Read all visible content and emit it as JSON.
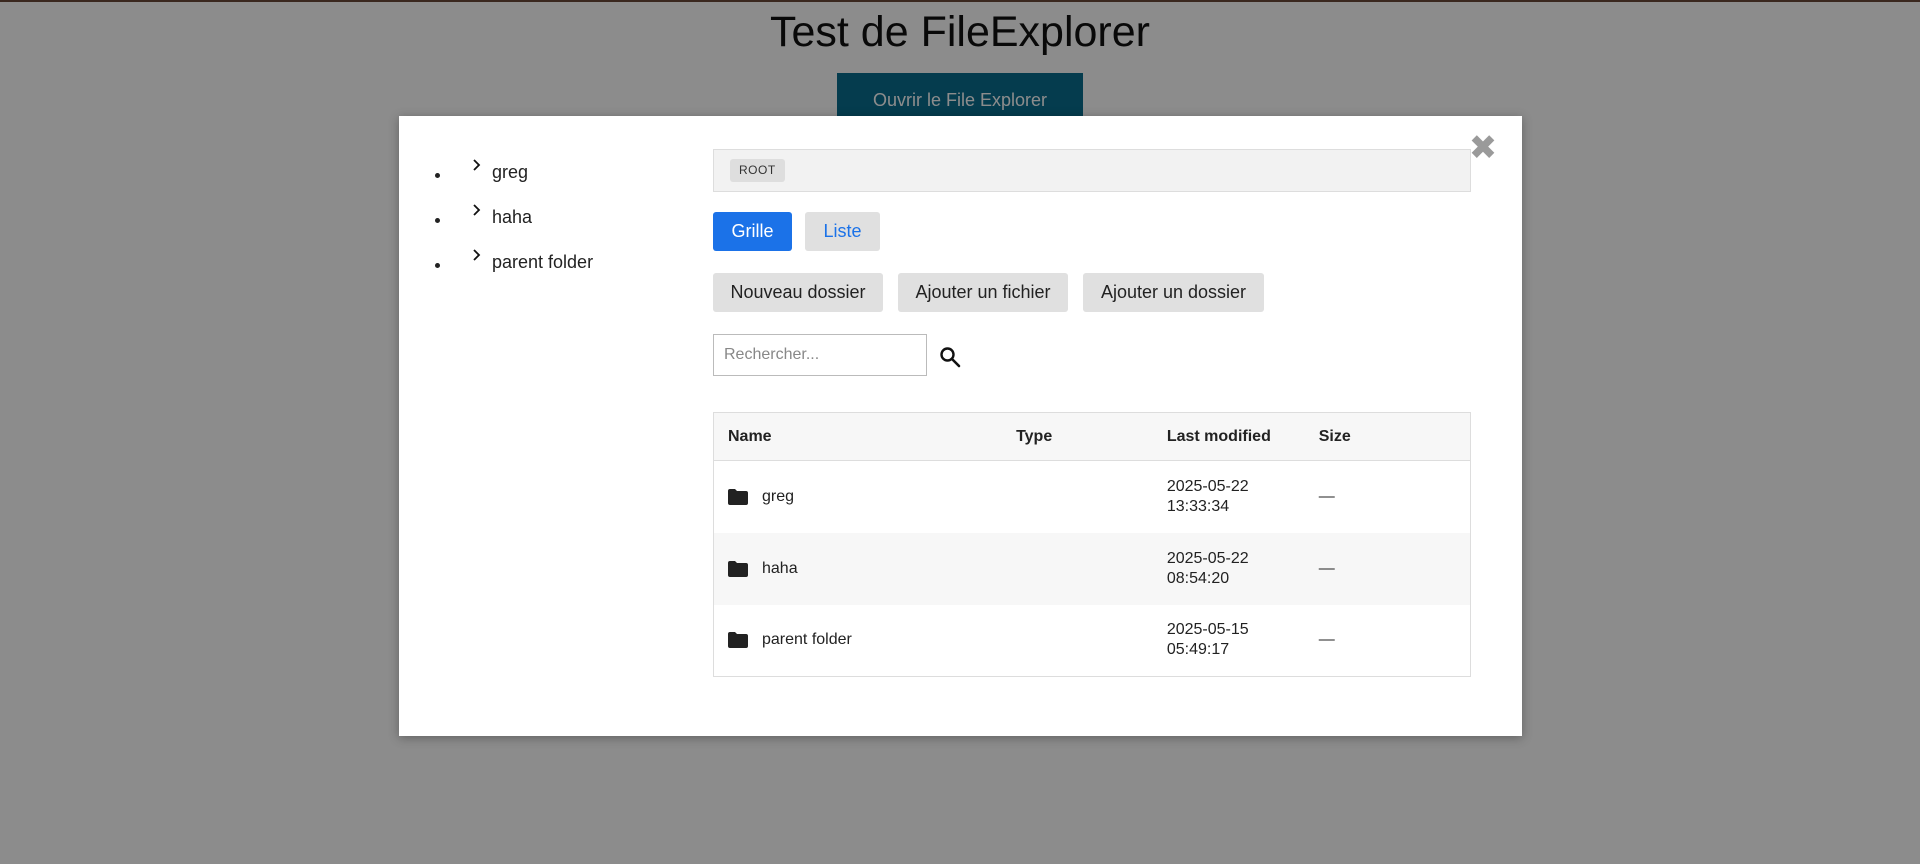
{
  "page": {
    "title": "Test de FileExplorer",
    "open_button": "Ouvrir le File Explorer"
  },
  "modal": {
    "close_label": "✖",
    "tree": [
      {
        "label": "greg"
      },
      {
        "label": "haha"
      },
      {
        "label": "parent folder"
      }
    ],
    "breadcrumb": [
      "ROOT"
    ],
    "views": {
      "grid": "Grille",
      "list": "Liste",
      "active": "grid"
    },
    "actions": {
      "new_folder": "Nouveau dossier",
      "add_file": "Ajouter un fichier",
      "add_folder": "Ajouter un dossier"
    },
    "search": {
      "placeholder": "Rechercher...",
      "value": ""
    },
    "table": {
      "columns": [
        "Name",
        "Type",
        "Last modified",
        "Size"
      ],
      "rows": [
        {
          "icon": "folder-icon",
          "name": "greg",
          "type": "",
          "modified": "2025-05-22 13:33:34",
          "size": "—"
        },
        {
          "icon": "folder-icon",
          "name": "haha",
          "type": "",
          "modified": "2025-05-22 08:54:20",
          "size": "—"
        },
        {
          "icon": "folder-icon",
          "name": "parent folder",
          "type": "",
          "modified": "2025-05-15 05:49:17",
          "size": "—"
        }
      ]
    }
  },
  "colors": {
    "primary": "#1b72e8",
    "open_button": "#0a6e8f",
    "overlay": "rgba(0,0,0,0.45)"
  }
}
